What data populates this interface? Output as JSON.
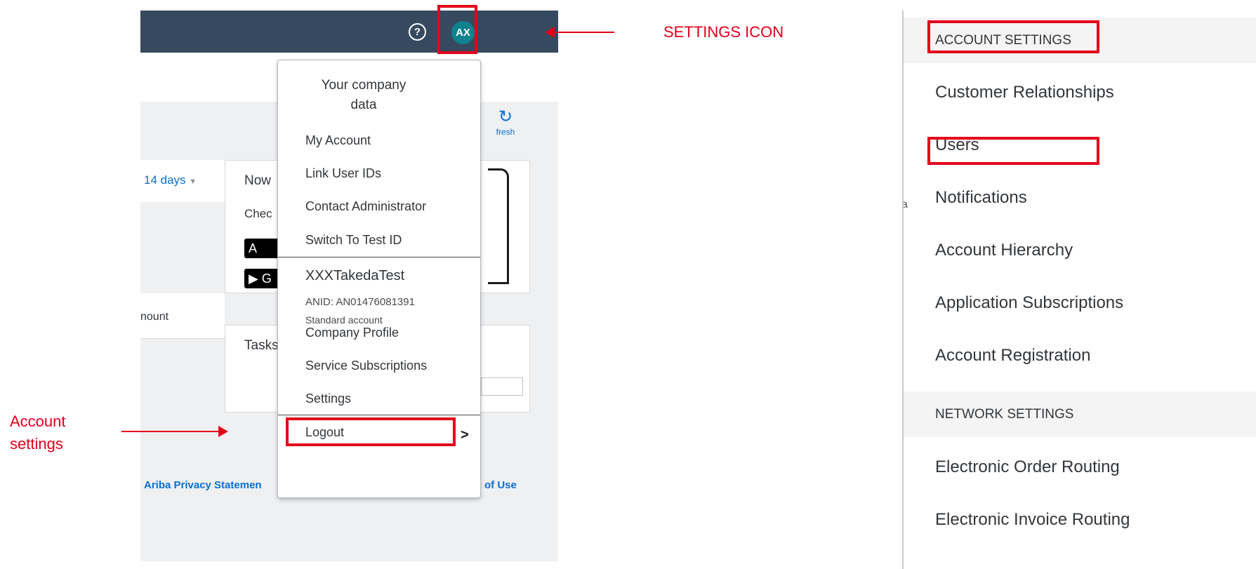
{
  "annotations": {
    "settings_icon": "SETTINGS ICON",
    "account_settings": "Account settings"
  },
  "left": {
    "header": {
      "help_icon": "?",
      "avatar_initials": "AX"
    },
    "refresh_label": "fresh",
    "date_filter": "14 days",
    "now_title": "Now",
    "check_text": "Chec",
    "store_badge_apple": "A",
    "store_badge_google": "G",
    "amount_label": "nount",
    "tasks_label": "Tasks",
    "footer": {
      "privacy": "Ariba Privacy Statemen",
      "terms": "of Use"
    }
  },
  "menu": {
    "header_line1": "Your company",
    "header_line2": "data",
    "items": [
      "My Account",
      "Link User IDs",
      "Contact Administrator",
      "Switch To Test ID"
    ],
    "company": {
      "name": "XXXTakedaTest",
      "anid": "ANID: AN01476081391",
      "account_type": "Standard account"
    },
    "company_items": [
      "Company Profile",
      "Service Subscriptions",
      "Settings"
    ],
    "logout": "Logout"
  },
  "settings_panel": {
    "account_settings_header": "ACCOUNT SETTINGS",
    "account_items": [
      "Customer Relationships",
      "Users",
      "Notifications",
      "Account Hierarchy",
      "Application Subscriptions",
      "Account Registration"
    ],
    "network_settings_header": "NETWORK SETTINGS",
    "network_items": [
      "Electronic Order Routing",
      "Electronic Invoice Routing"
    ],
    "left_stub": "a"
  },
  "colors": {
    "header_bg": "#354a5f",
    "avatar_bg": "#0f828f",
    "link": "#0a6ed1",
    "annotation_red": "#e2001a"
  }
}
